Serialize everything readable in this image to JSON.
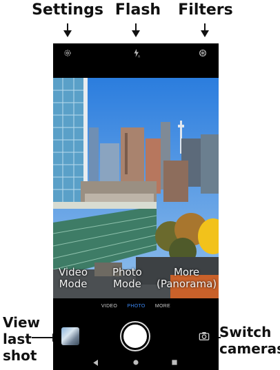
{
  "annotations": {
    "settings": "Settings",
    "flash": "Flash",
    "filters": "Filters",
    "view_last_shot": [
      "View",
      "last",
      "shot"
    ],
    "switch_cameras": [
      "Switch",
      "cameras"
    ]
  },
  "top_bar": {
    "icons": [
      "gear-icon",
      "flash-auto-icon",
      "filters-icon"
    ]
  },
  "viewfinder_overlay": {
    "video": [
      "Video",
      "Mode"
    ],
    "photo": [
      "Photo",
      "Mode"
    ],
    "more": [
      "More",
      "(Panorama)"
    ]
  },
  "mode_tabs": {
    "video": "VIDEO",
    "photo": "PHOTO",
    "more": "MORE",
    "active": "photo"
  },
  "controls": {
    "icons": [
      "thumbnail",
      "shutter",
      "camera-switch-icon"
    ]
  },
  "navbar": {
    "icons": [
      "back-icon",
      "home-icon",
      "recents-icon"
    ]
  },
  "colors": {
    "active_tab": "#3d8af7",
    "screen_bg": "#000000"
  }
}
